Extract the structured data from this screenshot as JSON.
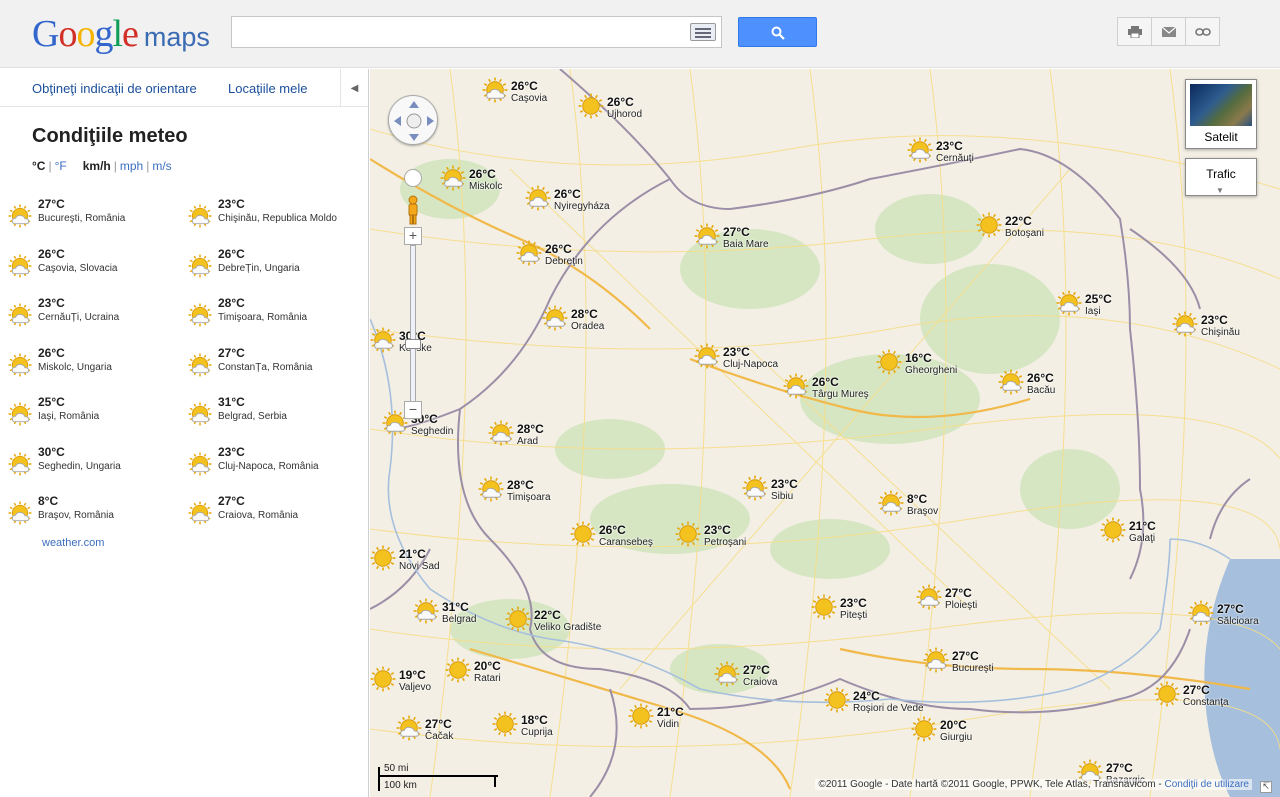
{
  "header": {
    "logo_google": "Google",
    "logo_maps": "maps",
    "search_value": ""
  },
  "left_panel": {
    "nav_directions": "Obţineţi indicaţii de orientare",
    "nav_my_places": "Locaţiile mele",
    "title": "Condiţiile meteo",
    "units": {
      "celsius": "°C",
      "fahrenheit": "°F",
      "kmh": "km/h",
      "mph": "mph",
      "ms": "m/s"
    },
    "list": [
      {
        "temp": "27°C",
        "city": "Bucureşti, România",
        "icon": "sun-cloud-icon"
      },
      {
        "temp": "23°C",
        "city": "Chişinău, Republica Moldo",
        "icon": "sun-cloud-icon"
      },
      {
        "temp": "26°C",
        "city": "Caşovia, Slovacia",
        "icon": "sun-cloud-icon"
      },
      {
        "temp": "26°C",
        "city": "DebreȚin, Ungaria",
        "icon": "sun-cloud-icon"
      },
      {
        "temp": "23°C",
        "city": "CernăuȚi, Ucraina",
        "icon": "sun-cloud-icon"
      },
      {
        "temp": "28°C",
        "city": "Timişoara, România",
        "icon": "sun-cloud-icon"
      },
      {
        "temp": "26°C",
        "city": "Miskolc, Ungaria",
        "icon": "sun-cloud-icon"
      },
      {
        "temp": "27°C",
        "city": "ConstanȚa, România",
        "icon": "sun-cloud-icon"
      },
      {
        "temp": "25°C",
        "city": "Iaşi, România",
        "icon": "sun-cloud-icon"
      },
      {
        "temp": "31°C",
        "city": "Belgrad, Serbia",
        "icon": "sun-cloud-icon"
      },
      {
        "temp": "30°C",
        "city": "Seghedin, Ungaria",
        "icon": "sun-cloud-icon"
      },
      {
        "temp": "23°C",
        "city": "Cluj-Napoca, România",
        "icon": "sun-cloud-icon"
      },
      {
        "temp": "8°C",
        "city": "Braşov, România",
        "icon": "sun-cloud-icon"
      },
      {
        "temp": "27°C",
        "city": "Craiova, România",
        "icon": "sun-cloud-icon"
      }
    ],
    "source_link": "weather.com"
  },
  "map": {
    "markers": [
      {
        "temp": "26°C",
        "city": "Caşovia",
        "icon": "sun-cloud-icon"
      },
      {
        "temp": "26°C",
        "city": "Ujhorod",
        "icon": "sun-icon"
      },
      {
        "temp": "23°C",
        "city": "Cernăuţi",
        "icon": "sun-cloud-icon"
      },
      {
        "temp": "26°C",
        "city": "Miskolc",
        "icon": "sun-cloud-icon"
      },
      {
        "temp": "26°C",
        "city": "Nyiregyháza",
        "icon": "sun-cloud-icon"
      },
      {
        "temp": "27°C",
        "city": "Baia Mare",
        "icon": "sun-cloud-icon"
      },
      {
        "temp": "22°C",
        "city": "Botoşani",
        "icon": "sun-icon"
      },
      {
        "temp": "26°C",
        "city": "Debreţin",
        "icon": "sun-cloud-icon"
      },
      {
        "temp": "25°C",
        "city": "Iaşi",
        "icon": "sun-cloud-icon"
      },
      {
        "temp": "23°C",
        "city": "Chişinău",
        "icon": "sun-cloud-icon"
      },
      {
        "temp": "28°C",
        "city": "Oradea",
        "icon": "sun-cloud-icon"
      },
      {
        "temp": "30°C",
        "city": "Kecske",
        "icon": "sun-cloud-icon"
      },
      {
        "temp": "23°C",
        "city": "Cluj-Napoca",
        "icon": "sun-cloud-icon"
      },
      {
        "temp": "16°C",
        "city": "Gheorgheni",
        "icon": "sun-icon"
      },
      {
        "temp": "26°C",
        "city": "Târgu Mureş",
        "icon": "sun-cloud-icon"
      },
      {
        "temp": "26°C",
        "city": "Bacău",
        "icon": "sun-cloud-icon"
      },
      {
        "temp": "30°C",
        "city": "Seghedin",
        "icon": "sun-cloud-icon"
      },
      {
        "temp": "28°C",
        "city": "Arad",
        "icon": "sun-cloud-icon"
      },
      {
        "temp": "28°C",
        "city": "Timişoara",
        "icon": "sun-cloud-icon"
      },
      {
        "temp": "23°C",
        "city": "Sibiu",
        "icon": "sun-cloud-icon"
      },
      {
        "temp": "8°C",
        "city": "Braşov",
        "icon": "sun-cloud-icon"
      },
      {
        "temp": "21°C",
        "city": "Galaţi",
        "icon": "sun-icon"
      },
      {
        "temp": "26°C",
        "city": "Caransebeş",
        "icon": "sun-icon"
      },
      {
        "temp": "23°C",
        "city": "Petroşani",
        "icon": "sun-icon"
      },
      {
        "temp": "21°C",
        "city": "Novi Sad",
        "icon": "sun-icon"
      },
      {
        "temp": "31°C",
        "city": "Belgrad",
        "icon": "sun-cloud-icon"
      },
      {
        "temp": "22°C",
        "city": "Veliko Gradište",
        "icon": "sun-icon"
      },
      {
        "temp": "23°C",
        "city": "Piteşti",
        "icon": "sun-icon"
      },
      {
        "temp": "27°C",
        "city": "Ploieşti",
        "icon": "sun-cloud-icon"
      },
      {
        "temp": "27°C",
        "city": "Sălcioara",
        "icon": "sun-cloud-icon"
      },
      {
        "temp": "19°C",
        "city": "Valjevo",
        "icon": "sun-icon"
      },
      {
        "temp": "20°C",
        "city": "Ratari",
        "icon": "sun-icon"
      },
      {
        "temp": "27°C",
        "city": "Craiova",
        "icon": "sun-cloud-icon"
      },
      {
        "temp": "27°C",
        "city": "Bucureşti",
        "icon": "sun-cloud-icon"
      },
      {
        "temp": "27°C",
        "city": "Constanţa",
        "icon": "sun-icon"
      },
      {
        "temp": "21°C",
        "city": "Vidin",
        "icon": "sun-icon"
      },
      {
        "temp": "24°C",
        "city": "Roşiori de Vede",
        "icon": "sun-icon"
      },
      {
        "temp": "27°C",
        "city": "Čačak",
        "icon": "sun-cloud-icon"
      },
      {
        "temp": "18°C",
        "city": "Cuprija",
        "icon": "sun-icon"
      },
      {
        "temp": "20°C",
        "city": "Giurgiu",
        "icon": "sun-icon"
      },
      {
        "temp": "27°C",
        "city": "Bazargic",
        "icon": "sun-cloud-icon"
      }
    ],
    "satellite_label": "Satelit",
    "traffic_label": "Trafic",
    "scale_top": "50 mi",
    "scale_bottom": "100 km",
    "copyright": "©2011 Google - Date hartă ©2011 Google, PPWK, Tele Atlas, Transnavicom - ",
    "terms": "Condiţii de utilizare",
    "colors": {
      "accent": "#4d90fe",
      "link": "#3c6ebf",
      "sun": "#f4c21f"
    }
  }
}
